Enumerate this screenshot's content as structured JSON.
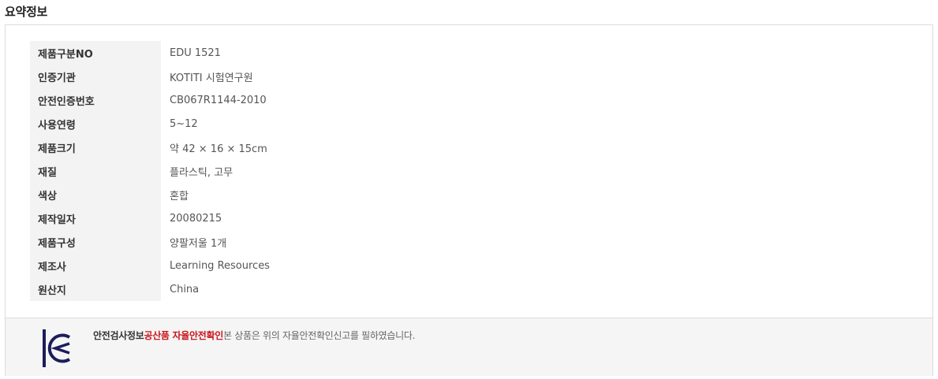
{
  "summary": {
    "title": "요약정보",
    "rows": [
      {
        "label": "제품구분NO",
        "value": "EDU 1521"
      },
      {
        "label": "인증기관",
        "value": "KOTITI 시험연구원"
      },
      {
        "label": "안전인증번호",
        "value": "CB067R1144-2010"
      },
      {
        "label": "사용연령",
        "value": "5~12"
      },
      {
        "label": "제품크기",
        "value": "약 42 × 16 × 15cm"
      },
      {
        "label": "재질",
        "value": "플라스틱, 고무"
      },
      {
        "label": "색상",
        "value": "혼합"
      },
      {
        "label": "제작일자",
        "value": "20080215"
      },
      {
        "label": "제품구성",
        "value": "양팔저울 1개"
      },
      {
        "label": "제조사",
        "value": "Learning Resources"
      },
      {
        "label": "원산지",
        "value": "China"
      }
    ]
  },
  "kc": {
    "label": "안전검사정보",
    "link_text": "공산품 자율안전확인",
    "description": "본 상품은 위의 자율안전확인신고를 필하였습니다.",
    "logo_icon": "kc-mark-icon",
    "logo_color": "#1c1c5c",
    "link_color": "#c8161d"
  }
}
